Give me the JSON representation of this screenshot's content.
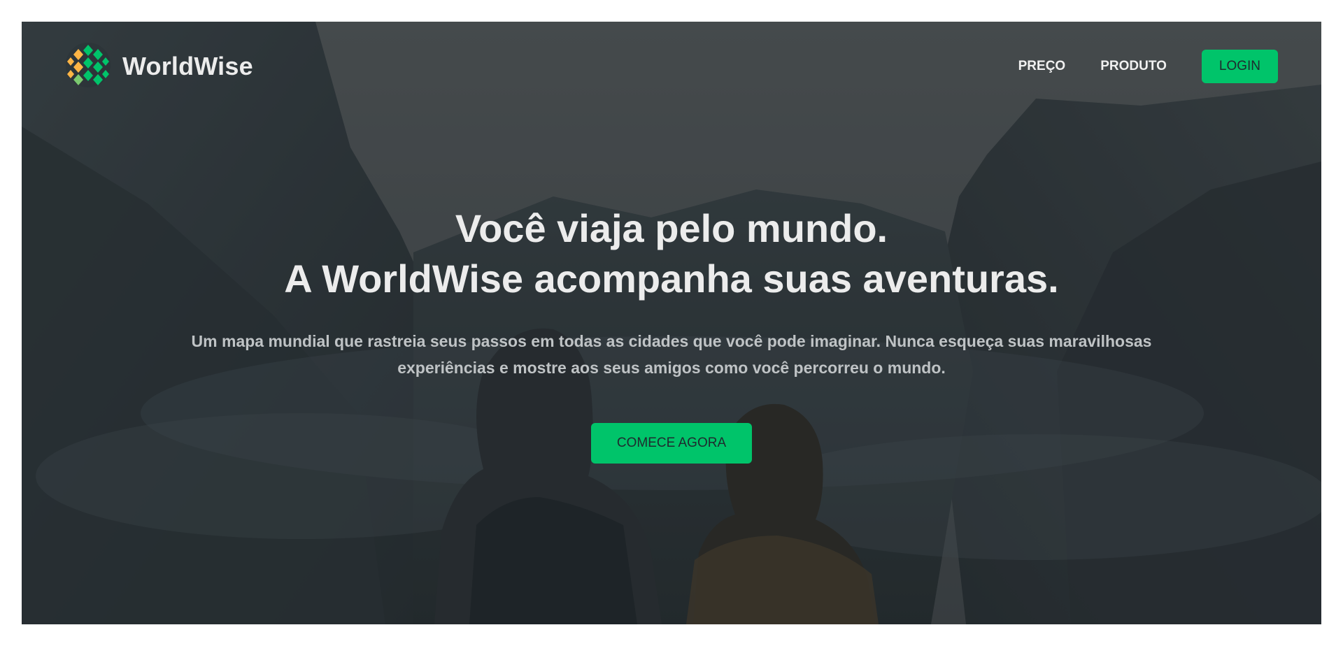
{
  "brand": {
    "name": "WorldWise",
    "logo_icon": "globe-icon",
    "accent_color": "#00c46a"
  },
  "nav": {
    "items": [
      {
        "label": "PREÇO"
      },
      {
        "label": "PRODUTO"
      }
    ],
    "login_label": "LOGIN"
  },
  "hero": {
    "headline_line1": "Você viaja pelo mundo.",
    "headline_line2": "A WorldWise acompanha suas aventuras.",
    "subtext": "Um mapa mundial que rastreia seus passos em todas as cidades que você pode imaginar. Nunca esqueça suas maravilhosas experiências e mostre aos seus amigos como você percorreu o mundo.",
    "cta_label": "COMECE AGORA"
  }
}
